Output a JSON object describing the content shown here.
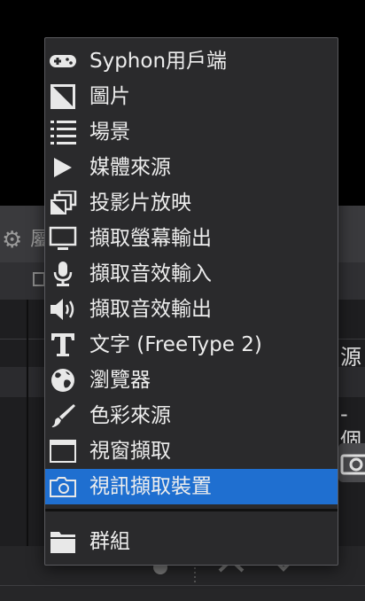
{
  "dock": {
    "title": "屬",
    "side_text_1": "源",
    "side_text_2": "-個"
  },
  "menu": {
    "items": [
      {
        "label": "Syphon用戶端",
        "icon": "gamepad-icon"
      },
      {
        "label": "圖片",
        "icon": "image-icon"
      },
      {
        "label": "場景",
        "icon": "list-icon"
      },
      {
        "label": "媒體來源",
        "icon": "play-icon"
      },
      {
        "label": "投影片放映",
        "icon": "slideshow-icon"
      },
      {
        "label": "擷取螢幕輸出",
        "icon": "monitor-icon"
      },
      {
        "label": "擷取音效輸入",
        "icon": "microphone-icon"
      },
      {
        "label": "擷取音效輸出",
        "icon": "speaker-icon"
      },
      {
        "label": "文字 (FreeType 2)",
        "icon": "text-icon"
      },
      {
        "label": "瀏覽器",
        "icon": "globe-icon"
      },
      {
        "label": "色彩來源",
        "icon": "brush-icon"
      },
      {
        "label": "視窗擷取",
        "icon": "window-icon"
      },
      {
        "label": "視訊擷取裝置",
        "icon": "camera-icon",
        "selected": true
      },
      {
        "label": "群組",
        "icon": "folder-icon"
      }
    ]
  },
  "colors": {
    "selection": "#1f6fd0",
    "menu_bg": "#2a2a2c",
    "text": "#ededed",
    "icon": "#e8e8e8"
  }
}
